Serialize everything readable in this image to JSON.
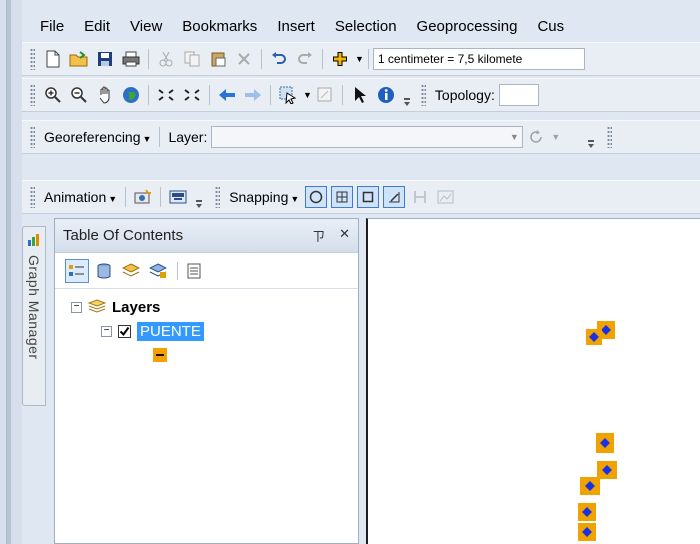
{
  "menu": [
    "File",
    "Edit",
    "View",
    "Bookmarks",
    "Insert",
    "Selection",
    "Geoprocessing",
    "Cus"
  ],
  "toolbar1": {
    "scale_value": "1 centimeter = 7,5 kilomete"
  },
  "toolbar2": {
    "topology_label": "Topology:"
  },
  "toolbar3": {
    "georeferencing_label": "Georeferencing",
    "layer_label": "Layer:"
  },
  "toolbar4": {
    "animation_label": "Animation",
    "snapping_label": "Snapping"
  },
  "graph_manager": {
    "label": "Graph Manager"
  },
  "toc": {
    "title": "Table Of Contents",
    "pin": "ㄗ",
    "close": "✕",
    "tree": {
      "root": {
        "label": "Layers",
        "expander": "⊟"
      },
      "layer": {
        "label": "PUENTE",
        "checked": true
      }
    }
  },
  "icons": {
    "new": "new-document-icon",
    "open": "open-folder-icon",
    "save": "save-icon",
    "print": "print-icon",
    "cut": "cut-icon",
    "copy": "copy-icon",
    "paste": "paste-icon",
    "delete": "delete-icon",
    "undo": "undo-icon",
    "redo": "redo-icon",
    "add_data": "add-data-icon",
    "zoom_in": "zoom-in-icon",
    "zoom_out": "zoom-out-icon",
    "pan": "pan-icon",
    "full_extent": "globe-icon",
    "identify": "identify-icon"
  },
  "colors": {
    "feature_fill": "#f0a200",
    "feature_marker": "#1830e6",
    "selection": "#3399ff"
  }
}
